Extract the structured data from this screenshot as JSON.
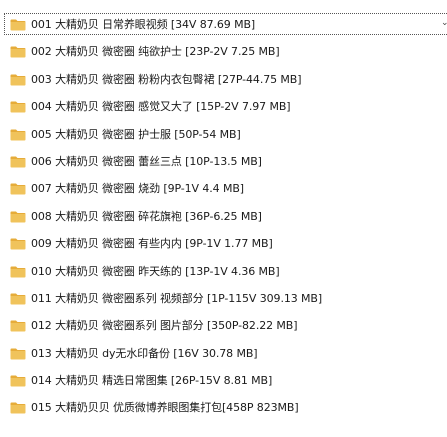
{
  "file_list": {
    "items": [
      {
        "name": "001 大精奶贝 日常养眼视频 [34V 87.69 MB]",
        "selected": true
      },
      {
        "name": "002 大精奶贝 微密圈 纯欲护士 [23P-2V 7.25 MB]"
      },
      {
        "name": "003 大精奶贝 微密圈 粉粉内衣包臀裙 [27P-44.75 MB]"
      },
      {
        "name": "004 大精奶贝 微密圈 感觉又大了 [15P-2V 7.97 MB]"
      },
      {
        "name": "005 大精奶贝 微密圈 护士服 [50P-54 MB]"
      },
      {
        "name": "006 大精奶贝 微密圈 蕾丝三点 [10P-13.5 MB]"
      },
      {
        "name": "007 大精奶贝 微密圈 烧劲 [9P-1V 4.4 MB]"
      },
      {
        "name": "008 大精奶贝 微密圈 碎花旗袍 [36P-6.25 MB]"
      },
      {
        "name": "009 大精奶贝 微密圈 有些内内 [9P-1V 1.77 MB]"
      },
      {
        "name": "010 大精奶贝 微密圈 昨天练的 [13P-1V 4.36 MB]"
      },
      {
        "name": "011 大精奶贝 微密圈系列 视频部分 [1P-115V 309.13 MB]"
      },
      {
        "name": "012 大精奶贝 微密圈系列 图片部分 [350P-82.22 MB]"
      },
      {
        "name": "013 大精奶贝 dy无水印备份 [16V 30.78 MB]"
      },
      {
        "name": "014 大精奶贝 精选日常图集 [26P-15V 8.81 MB]"
      },
      {
        "name": "015 大精奶贝贝 优质微博养眼图集打包[458P 823MB]"
      }
    ]
  },
  "icons": {
    "folder": "folder-icon",
    "folder_color": "#f0c35b",
    "folder_tab_color": "#e6ac3a"
  },
  "edge_marker_glyph": "⌄"
}
